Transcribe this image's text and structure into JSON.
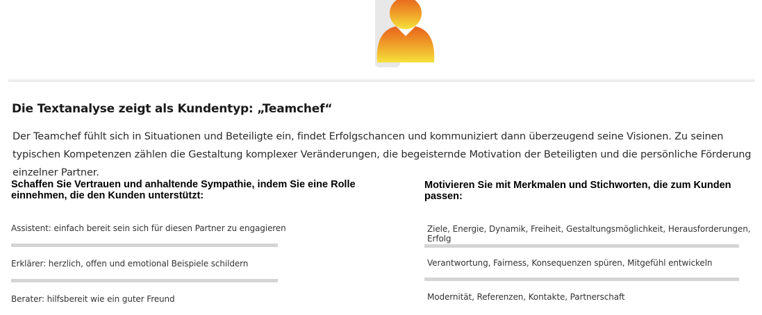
{
  "profile": {
    "avatar_icon": "user-silhouette-icon",
    "avatar_gradient": [
      "#e8611c",
      "#f5d93a"
    ]
  },
  "analysis": {
    "title": "Die Textanalyse zeigt als Kundentyp: „Teamchef“",
    "description": "Der Teamchef fühlt sich in Situationen und Beteiligte ein, findet Erfolgschancen und kommuniziert dann überzeugend seine Visionen. Zu seinen typischen Kompetenzen zählen die Gestaltung komplexer Veränderungen, die begeisternde Motivation der Beteiligten und die persönliche Förderung einzelner Partner."
  },
  "left_column": {
    "heading": "Schaffen Sie Vertrauen und anhaltende Sympathie, indem Sie eine Rolle einnehmen, die den Kunden unterstützt:",
    "items": [
      "Assistent: einfach bereit sein sich für diesen Partner zu engagieren",
      "Erklärer: herzlich, offen und emotional Beispiele schildern",
      "Berater: hilfsbereit wie ein guter Freund"
    ]
  },
  "right_column": {
    "heading": "Motivieren Sie mit Merkmalen und Stichworten, die zum Kunden passen:",
    "items": [
      "Ziele, Energie, Dynamik, Freiheit, Gestaltungsmöglichkeit, Herausforderungen, Erfolg",
      "Verantwortung, Fairness, Konsequenzen spüren, Mitgefühl entwickeln",
      "Modernität, Referenzen, Kontakte, Partnerschaft"
    ]
  }
}
